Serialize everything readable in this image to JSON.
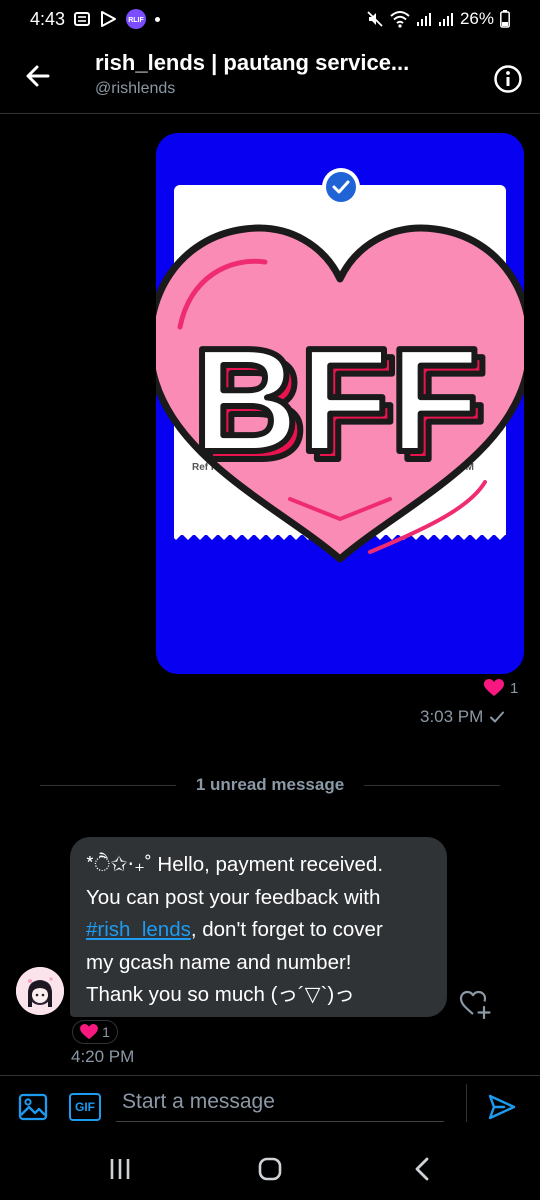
{
  "status_bar": {
    "time": "4:43",
    "battery": "26%",
    "badge_text": "RLIF"
  },
  "header": {
    "title": "rish_lends | pautang service...",
    "handle": "@rishlends"
  },
  "sent_image": {
    "sticker_text": "BFF",
    "receipt_ref": "Ref I",
    "receipt_time": "PM",
    "reaction_count": "1",
    "time": "3:03 PM"
  },
  "divider": {
    "text": "1 unread message"
  },
  "received_message": {
    "line1": "*ੈ✩‧₊˚ Hello, payment received.",
    "line2": "You can post your feedback with",
    "hashtag": "#rish_lends",
    "line3_rest": ", don't forget to cover",
    "line4": "my gcash name and number!",
    "line5": "Thank you so much (っ´▽`)っ",
    "reaction_count": "1",
    "time": "4:20 PM"
  },
  "composer": {
    "placeholder": "Start a message",
    "gif_label": "GIF"
  },
  "colors": {
    "accent": "#1d9bf0",
    "bubble": "#2f3336",
    "image_bg": "#0800f0",
    "heart": "#f98bb5",
    "reaction": "#f91880"
  }
}
